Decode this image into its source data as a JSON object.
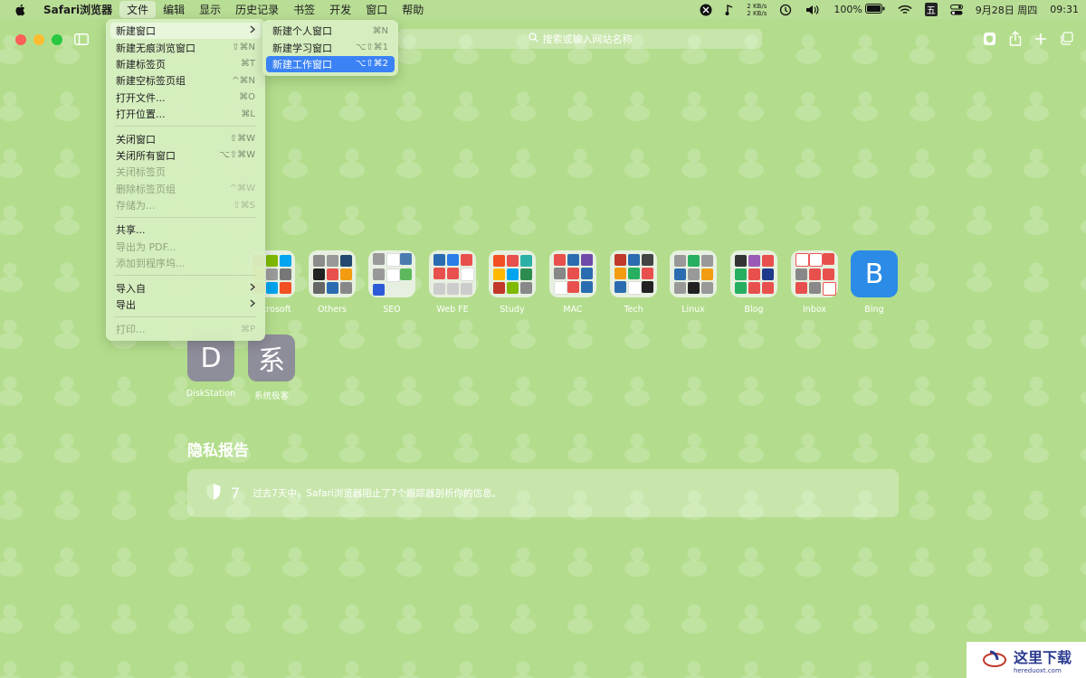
{
  "menubar": {
    "app_name": "Safari浏览器",
    "menus": [
      "文件",
      "编辑",
      "显示",
      "历史记录",
      "书签",
      "开发",
      "窗口",
      "帮助"
    ],
    "net_up": "2 KB/s",
    "net_down": "2 KB/s",
    "battery": "100%",
    "ime": "五",
    "date": "9月28日 周四",
    "time": "09:31"
  },
  "toolbar": {
    "search_placeholder": "搜索或输入网站名称"
  },
  "file_menu": {
    "group1": [
      {
        "label": "新建窗口",
        "shortcut": ""
      },
      {
        "label": "新建无痕浏览窗口",
        "shortcut": "⇧⌘N"
      },
      {
        "label": "新建标签页",
        "shortcut": "⌘T"
      },
      {
        "label": "新建空标签页组",
        "shortcut": "^⌘N"
      },
      {
        "label": "打开文件...",
        "shortcut": "⌘O"
      },
      {
        "label": "打开位置...",
        "shortcut": "⌘L"
      }
    ],
    "group2": [
      {
        "label": "关闭窗口",
        "shortcut": "⇧⌘W"
      },
      {
        "label": "关闭所有窗口",
        "shortcut": "⌥⇧⌘W"
      },
      {
        "label": "关闭标签页",
        "shortcut": ""
      },
      {
        "label": "删除标签页组",
        "shortcut": "^⌘W"
      },
      {
        "label": "存储为...",
        "shortcut": "⇧⌘S"
      }
    ],
    "group3": [
      {
        "label": "共享..."
      },
      {
        "label": "导出为 PDF..."
      },
      {
        "label": "添加到程序坞..."
      }
    ],
    "group4": [
      {
        "label": "导入自"
      },
      {
        "label": "导出"
      }
    ],
    "group5": [
      {
        "label": "打印...",
        "shortcut": "⌘P"
      }
    ]
  },
  "submenu": [
    {
      "label": "新建个人窗口",
      "shortcut": "⌘N"
    },
    {
      "label": "新建学习窗口",
      "shortcut": "⌥⇧⌘1"
    },
    {
      "label": "新建工作窗口",
      "shortcut": "⌥⇧⌘2"
    }
  ],
  "favorites": [
    {
      "label": "Microsoft"
    },
    {
      "label": "Others"
    },
    {
      "label": "SEO"
    },
    {
      "label": "Web FE"
    },
    {
      "label": "Study"
    },
    {
      "label": "MAC"
    },
    {
      "label": "Tech"
    },
    {
      "label": "Linux"
    },
    {
      "label": "Blog"
    },
    {
      "label": "Inbox"
    },
    {
      "label": "Bing",
      "letter": "B"
    },
    {
      "label": "DiskStation",
      "letter": "D"
    },
    {
      "label": "系统极客",
      "letter": "系"
    }
  ],
  "privacy": {
    "title": "隐私报告",
    "count": "7",
    "text": "过去7天中，Safari浏览器阻止了7个跟踪器剖析你的信息。"
  },
  "watermark": {
    "text": "这里下载",
    "url": "hereduoxt.com"
  },
  "colors": {
    "accent": "#3b82f6",
    "bing": "#2b8be6",
    "letter_tile": "#8e8d9a"
  }
}
